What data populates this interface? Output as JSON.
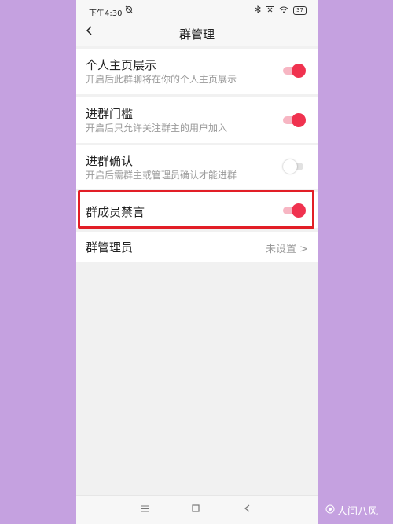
{
  "status_bar": {
    "time": "下午4:30",
    "battery": "37"
  },
  "header": {
    "title": "群管理"
  },
  "settings": [
    {
      "label": "个人主页展示",
      "description": "开启后此群聊将在你的个人主页展示",
      "enabled": true
    },
    {
      "label": "进群门槛",
      "description": "开启后只允许关注群主的用户加入",
      "enabled": true
    },
    {
      "label": "进群确认",
      "description": "开启后需群主或管理员确认才能进群",
      "enabled": false
    },
    {
      "label": "群成员禁言",
      "enabled": true
    }
  ],
  "admin_row": {
    "label": "群管理员",
    "value": "未设置 >"
  },
  "watermark": {
    "text": "人间八风"
  },
  "colors": {
    "accent": "#f0324f",
    "highlight_border": "#e21e26",
    "background": "#c5a1e0"
  }
}
